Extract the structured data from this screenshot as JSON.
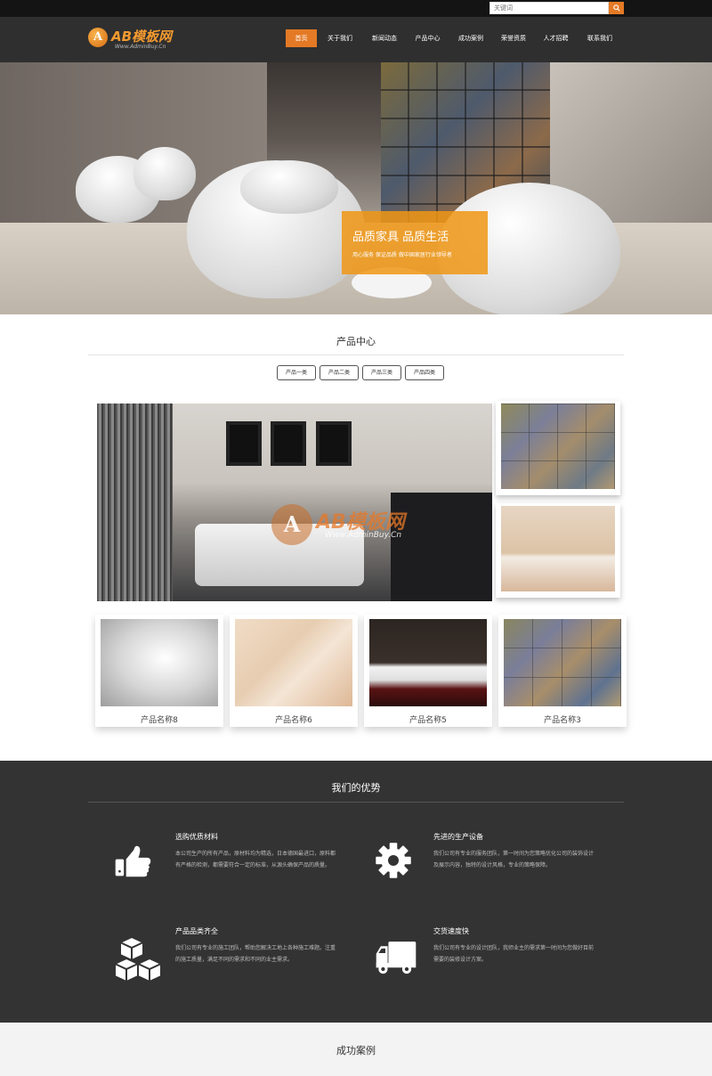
{
  "topbar": {
    "search_placeholder": "关键词",
    "search_button": "⌕"
  },
  "logo": {
    "mark": "A",
    "title": "AB模板网",
    "subtitle": "Www.AdminBuy.Cn"
  },
  "nav": {
    "items": [
      "首页",
      "关于我们",
      "新闻动态",
      "产品中心",
      "成功案例",
      "荣誉资质",
      "人才招聘",
      "联系我们"
    ],
    "active_index": 0
  },
  "hero": {
    "title": "品质家具 品质生活",
    "subtitle": "用心服务 保证品质 做中国家居行业领导者"
  },
  "products": {
    "title": "产品中心",
    "tabs": [
      "产品一类",
      "产品二类",
      "产品三类",
      "产品四类"
    ],
    "watermark": {
      "mark": "A",
      "title": "AB模板网",
      "url": "Www.AdminBuy.Cn"
    },
    "items": [
      {
        "name": "产品名称8"
      },
      {
        "name": "产品名称6"
      },
      {
        "name": "产品名称5"
      },
      {
        "name": "产品名称3"
      }
    ]
  },
  "advantages": {
    "title": "我们的优势",
    "items": [
      {
        "icon": "thumbs-up-icon",
        "title": "选购优质材料",
        "text": "本公司生产的所有产品，原材料均为精选，日本德国最进口，原料都有严格的检测，都需要符合一定的标准，从源头确保产品的质量。"
      },
      {
        "icon": "gear-icon",
        "title": "先进的生产设备",
        "text": "我们公司有专业的服务团队，第一时间为您策略优化公司的装饰设计及展示内容，独特的设计风格，专业的策略保障。"
      },
      {
        "icon": "boxes-icon",
        "title": "产品品类齐全",
        "text": "我们公司有专业的施工团队，帮助您解决工地上各种施工难题。注重的施工质量，满足不同的需求和不同的业主需求。"
      },
      {
        "icon": "truck-icon",
        "title": "交货速度快",
        "text": "我们公司有专业的设计团队，我师业主的需求第一时间为您做好目前需要的装修设计方案。"
      }
    ]
  },
  "cases": {
    "title": "成功案例"
  },
  "colors": {
    "accent": "#e47a25",
    "header_bg": "#2f2f2f",
    "topbar_bg": "#141414",
    "advantages_bg": "#333333"
  }
}
